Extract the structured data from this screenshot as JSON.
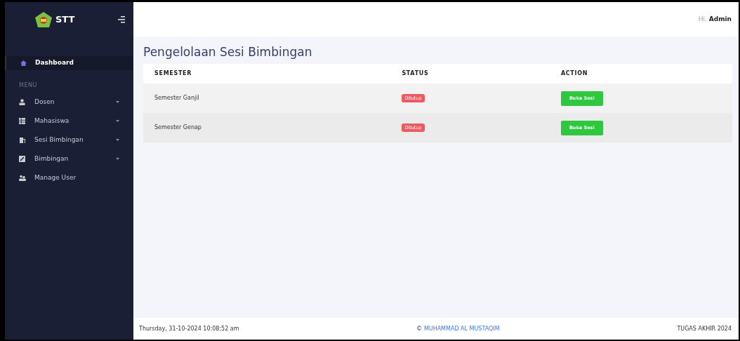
{
  "sidebar": {
    "brand": "STT",
    "dashboard": {
      "label": "Dashboard",
      "selected": true
    },
    "section_label": "MENU",
    "items": [
      {
        "label": "Dosen",
        "kind": "user",
        "expandable": true
      },
      {
        "label": "Mahasiswa",
        "kind": "table",
        "expandable": true
      },
      {
        "label": "Sesi Bimbingan",
        "kind": "door",
        "expandable": true
      },
      {
        "label": "Bimbingan",
        "kind": "edit",
        "expandable": true
      },
      {
        "label": "Manage User",
        "kind": "users",
        "expandable": false
      }
    ]
  },
  "topbar": {
    "greeting": "Hi,",
    "user": "Admin"
  },
  "page_title": "Pengelolaan Sesi Bimbingan",
  "table": {
    "columns": [
      "SEMESTER",
      "STATUS",
      "ACTION"
    ],
    "rows": [
      {
        "semester": "Semester Ganjil",
        "status": "Ditutup",
        "action": "Buka Sesi"
      },
      {
        "semester": "Semester Genap",
        "status": "Ditutup",
        "action": "Buka Sesi"
      }
    ]
  },
  "footer": {
    "datetime": "Thursday, 31-10-2024 10:08:52 am",
    "copyright_symbol": "©",
    "author": "MUHAMMAD AL MUSTAQIM",
    "right": "TUGAS AKHIR 2024"
  }
}
